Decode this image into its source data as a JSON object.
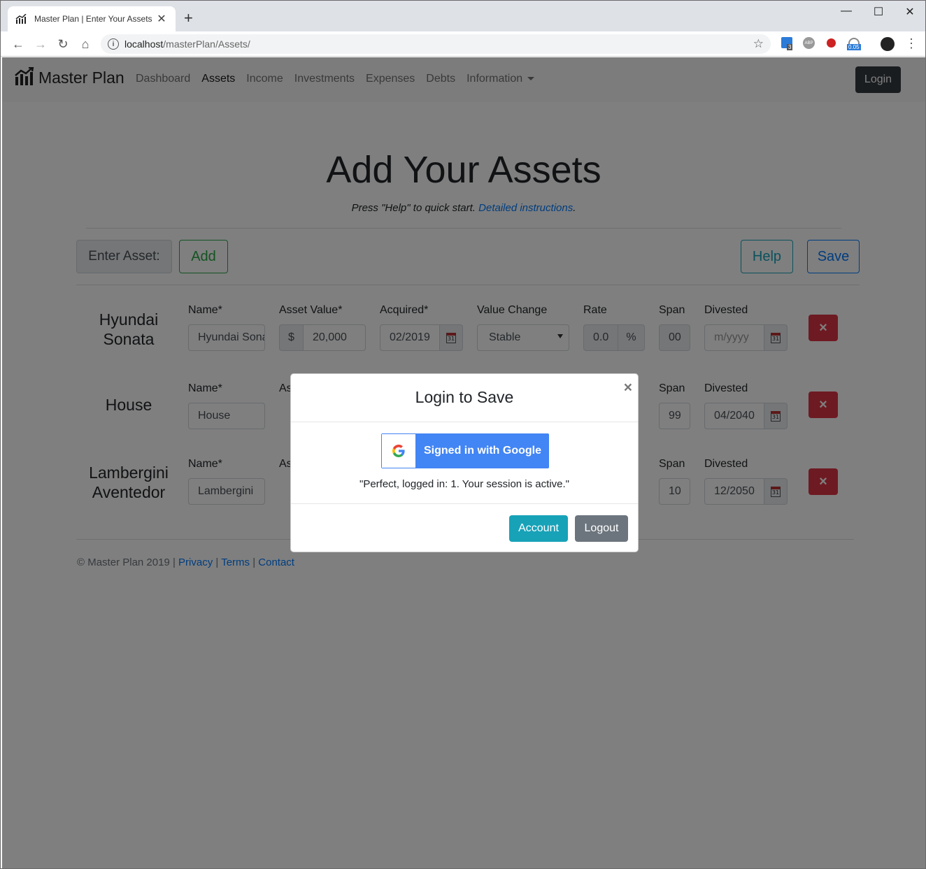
{
  "browser": {
    "tab_title": "Master Plan | Enter Your Assets",
    "url_host": "localhost",
    "url_path": "/masterPlan/Assets/",
    "ext_badges": [
      "3",
      "ABP",
      "0.05"
    ]
  },
  "navbar": {
    "brand": "Master Plan",
    "links": [
      "Dashboard",
      "Assets",
      "Income",
      "Investments",
      "Expenses",
      "Debts",
      "Information"
    ],
    "active": "Assets",
    "login": "Login"
  },
  "main": {
    "title": "Add Your Assets",
    "subtitle_prefix": "Press \"Help\" to quick start. ",
    "subtitle_link": "Detailed instructions",
    "subtitle_suffix": "."
  },
  "toolbar": {
    "enter_label": "Enter Asset:",
    "add": "Add",
    "help": "Help",
    "save": "Save"
  },
  "labels": {
    "name": "Name*",
    "asset_value": "Asset Value*",
    "acquired": "Acquired*",
    "value_change": "Value Change",
    "rate": "Rate",
    "span": "Span",
    "divested": "Divested",
    "dollar": "$",
    "percent": "%",
    "cal": "31",
    "delete": "×"
  },
  "assets": [
    {
      "title_line1": "Hyundai",
      "title_line2": "Sonata",
      "name": "Hyundai Sonata",
      "value": "20,000",
      "acquired": "02/2019",
      "value_change": "Stable",
      "rate": "0.0",
      "span": "00",
      "divested": "m/yyyy"
    },
    {
      "title_line1": "House",
      "title_line2": "",
      "name": "House",
      "span": "99",
      "divested": "04/2040"
    },
    {
      "title_line1": "Lambergini",
      "title_line2": "Aventedor",
      "name": "Lambergini",
      "span": "10",
      "divested": "12/2050"
    }
  ],
  "partial_labels": {
    "asset_value_cut": "As"
  },
  "footer": {
    "copyright": "© Master Plan 2019 | ",
    "privacy": "Privacy",
    "sep": " | ",
    "terms": "Terms",
    "contact": "Contact"
  },
  "modal": {
    "title": "Login to Save",
    "close": "×",
    "google_button": "Signed in with Google",
    "message": "\"Perfect, logged in: 1. Your session is active.\"",
    "account": "Account",
    "logout": "Logout"
  },
  "colors": {
    "primary": "#007bff",
    "success": "#28a745",
    "info": "#17a2b8",
    "danger": "#dc3545",
    "secondary": "#6c757d",
    "dark": "#343a40",
    "google_blue": "#4285f4"
  }
}
